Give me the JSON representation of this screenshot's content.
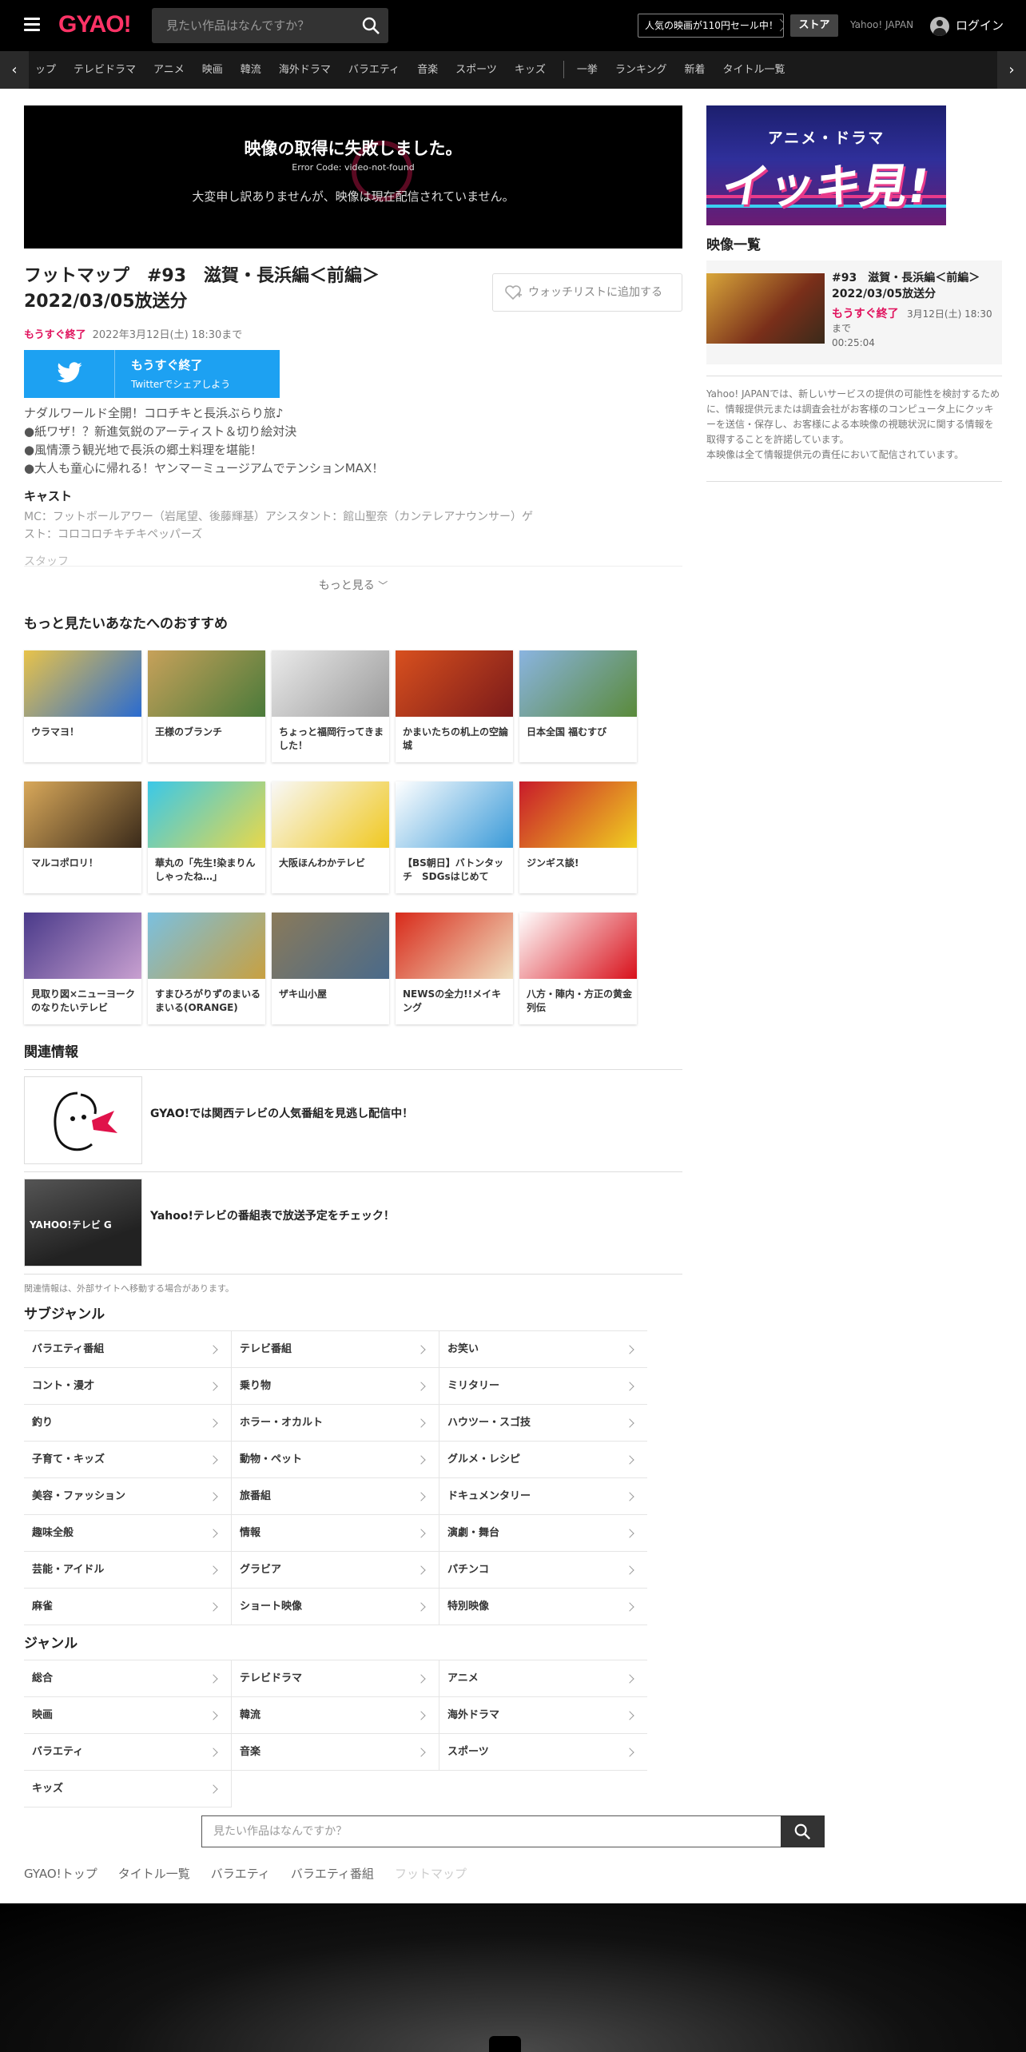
{
  "header": {
    "logo": "GYAO!",
    "search_placeholder": "見たい作品はなんですか？",
    "promo": "人気の映画が110円セール中！",
    "store": "ストア",
    "yahoo_japan": "Yahoo! JAPAN",
    "login": "ログイン"
  },
  "subnav": {
    "items_a": [
      "ップ",
      "テレビドラマ",
      "アニメ",
      "映画",
      "韓流",
      "海外ドラマ",
      "バラエティ",
      "音楽",
      "スポーツ",
      "キッズ"
    ],
    "items_b": [
      "一挙",
      "ランキング",
      "新着",
      "タイトル一覧"
    ]
  },
  "player": {
    "error_title": "映像の取得に失敗しました。",
    "error_code": "Error Code: video-not-found",
    "error_message": "大変申し訳ありませんが、映像は現在配信されていません。"
  },
  "episode": {
    "title": "フットマップ　#93　滋賀・長浜編＜前編＞　2022/03/05放送分",
    "watchlist": "ウォッチリストに追加する",
    "status": "もうすぐ終了",
    "until": "2022年3月12日(土) 18:30まで",
    "twitter_line1": "もうすぐ終了",
    "twitter_line2": "Twitterでシェアしよう",
    "description": [
      "ナダルワールド全開！コロチキと長浜ぶらり旅♪",
      "●紙ワザ！？新進気鋭のアーティスト＆切り絵対決",
      "●風情漂う観光地で長浜の郷土料理を堪能！",
      "●大人も童心に帰れる！ヤンマーミュージアムでテンションMAX！"
    ],
    "cast_heading": "キャスト",
    "cast_body": "MC：フットボールアワー（岩尾望、後藤輝基）アシスタント：館山聖奈（カンテレアナウンサー）ゲスト：コロコロチキチキペッパーズ",
    "staff_heading": "スタッフ",
    "more": "もっと見る"
  },
  "recommend": {
    "heading": "もっと見たいあなたへのおすすめ",
    "items": [
      "ウラマヨ！",
      "王様のブランチ",
      "ちょっと福岡行ってきました！",
      "かまいたちの机上の空論城",
      "日本全国 福むすび",
      "マルコポロリ！",
      "華丸の「先生!染まりんしゃったね…」",
      "大阪ほんわかテレビ",
      "【BS朝日】バトンタッチ　SDGsはじめて",
      "ジンギス談!",
      "見取り図×ニューヨークのなりたいテレビ",
      "すまひろがりずのまいるまいる(ORANGE)",
      "ザキ山小屋",
      "NEWSの全力!!メイキング",
      "八方・陣内・方正の黄金列伝"
    ]
  },
  "related": {
    "heading": "関連情報",
    "item1": "GYAO!では関西テレビの人気番組を見逃し配信中！",
    "item2": "Yahoo!テレビの番組表で放送予定をチェック！",
    "item2_logo": "YAHOO!テレビ G",
    "note": "関連情報は、外部サイトへ移動する場合があります。"
  },
  "subgenre": {
    "heading": "サブジャンル",
    "items": [
      "バラエティ番組",
      "テレビ番組",
      "お笑い",
      "コント・漫才",
      "乗り物",
      "ミリタリー",
      "釣り",
      "ホラー・オカルト",
      "ハウツー・スゴ技",
      "子育て・キッズ",
      "動物・ペット",
      "グルメ・レシピ",
      "美容・ファッション",
      "旅番組",
      "ドキュメンタリー",
      "趣味全般",
      "情報",
      "演劇・舞台",
      "芸能・アイドル",
      "グラビア",
      "パチンコ",
      "麻雀",
      "ショート映像",
      "特別映像"
    ]
  },
  "genre": {
    "heading": "ジャンル",
    "items": [
      "総合",
      "テレビドラマ",
      "アニメ",
      "映画",
      "韓流",
      "海外ドラマ",
      "バラエティ",
      "音楽",
      "スポーツ",
      "キッズ"
    ]
  },
  "bottom_search_placeholder": "見たい作品はなんですか？",
  "breadcrumb": [
    "GYAO!トップ",
    "タイトル一覧",
    "バラエティ",
    "バラエティ番組",
    "フットマップ"
  ],
  "sidebar": {
    "banner_line1": "アニメ・ドラマ",
    "banner_line2": "イッキ見!",
    "video_list_heading": "映像一覧",
    "video": {
      "title": "#93　滋賀・長浜編＜前編＞　2022/03/05放送分",
      "status": "もうすぐ終了",
      "until": "3月12日(土) 18:30まで",
      "duration": "00:25:04"
    },
    "notice": [
      "Yahoo! JAPANでは、新しいサービスの提供の可能性を検討するために、情報提供元または調査会社がお客様のコンピュータ上にクッキーを送信・保存し、お客様による本映像の視聴状況に関する情報を取得することを許諾しています。",
      "本映像は全て情報提供元の責任において配信されています。"
    ]
  },
  "colors": {
    "accent": "#e0125d",
    "twitter": "#1da1f2",
    "header_bg": "#000000"
  }
}
